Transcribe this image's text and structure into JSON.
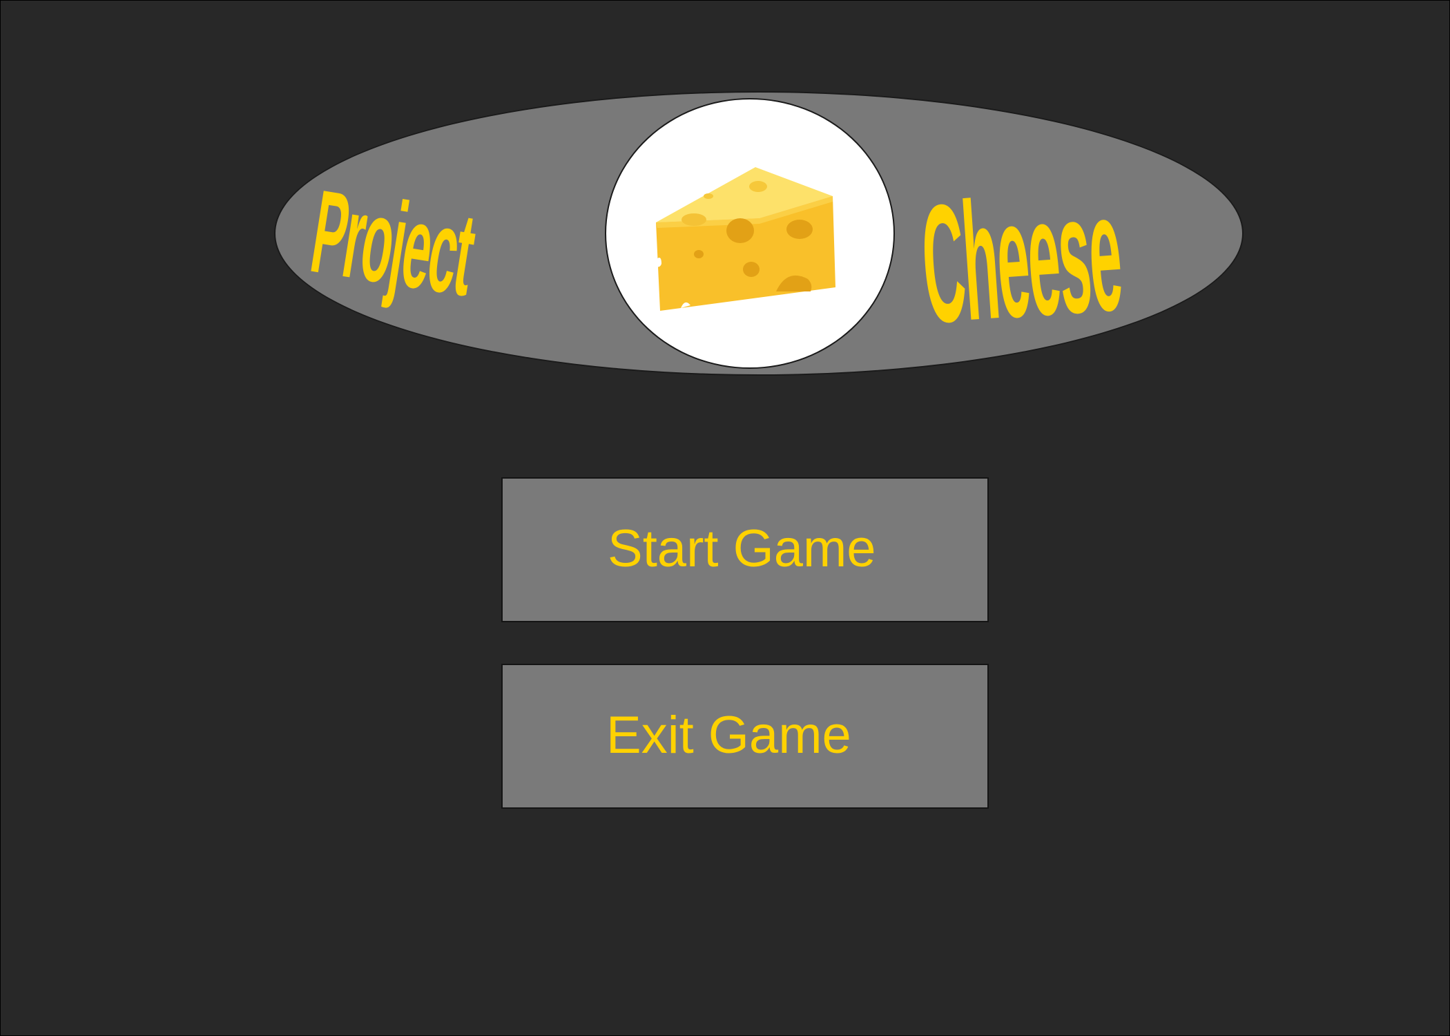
{
  "title": {
    "word_left": "Project",
    "word_right": "Cheese",
    "logo_icon": "cheese-wedge-icon"
  },
  "menu": {
    "start_label": "Start Game",
    "exit_label": "Exit Game"
  },
  "colors": {
    "background": "#282828",
    "panel_gray": "#797979",
    "accent_yellow": "#ffd200",
    "emblem_white": "#ffffff",
    "cheese_light": "#fde16a",
    "cheese_main": "#f9c02a",
    "cheese_hole": "#e2a116"
  }
}
